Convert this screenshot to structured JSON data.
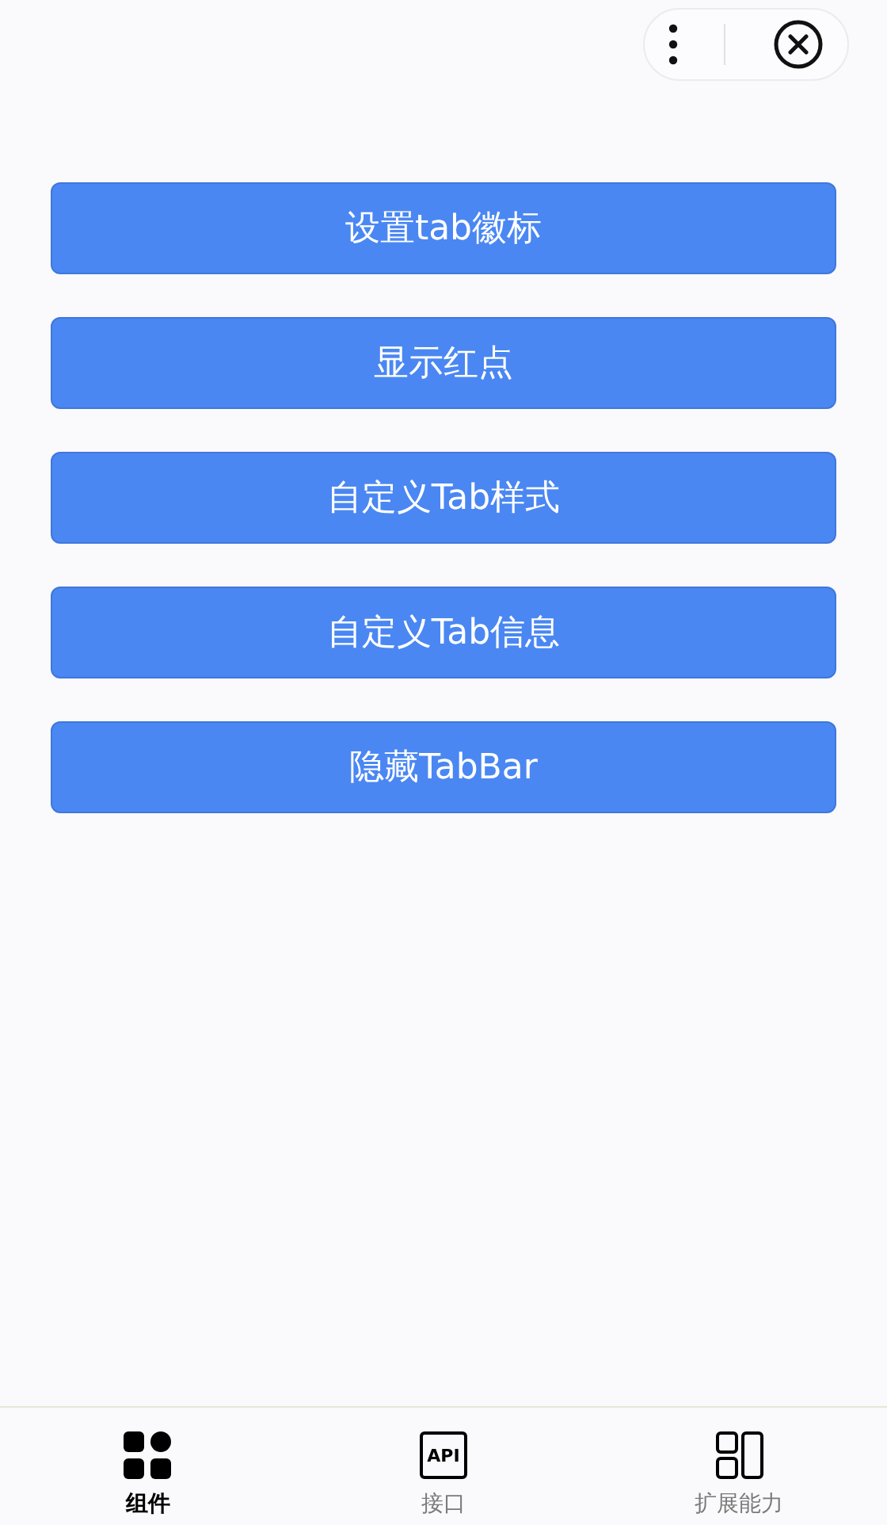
{
  "buttons": [
    {
      "label": "设置tab徽标"
    },
    {
      "label": "显示红点"
    },
    {
      "label": "自定义Tab样式"
    },
    {
      "label": "自定义Tab信息"
    },
    {
      "label": "隐藏TabBar"
    }
  ],
  "tab_bar": [
    {
      "label": "组件",
      "kind": "grid",
      "selected": true
    },
    {
      "label": "接口",
      "kind": "api",
      "icon_text": "API",
      "selected": false
    },
    {
      "label": "扩展能力",
      "kind": "panels",
      "selected": false
    }
  ]
}
